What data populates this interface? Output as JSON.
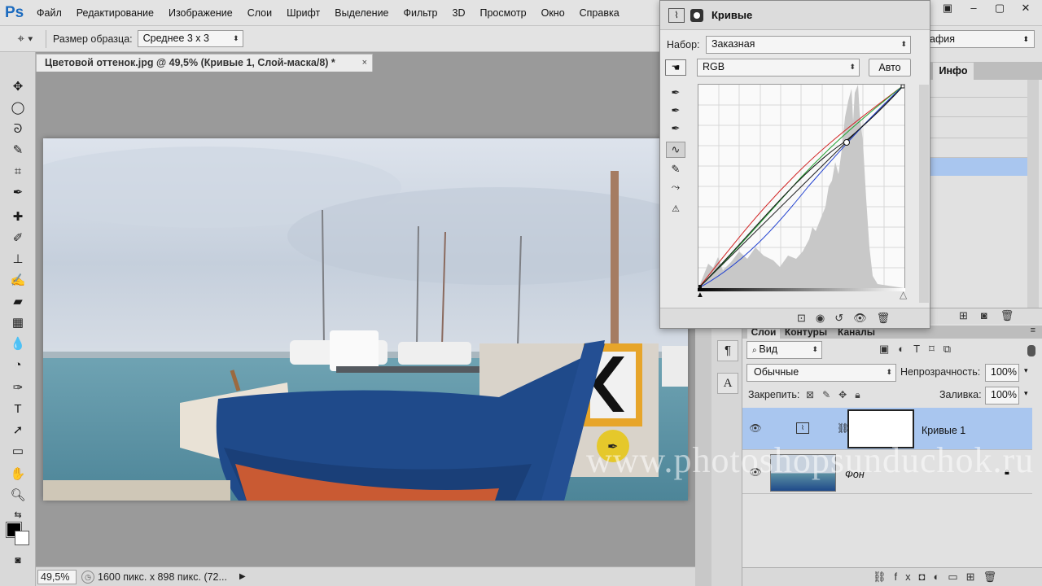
{
  "app": {
    "logo": "Ps"
  },
  "menu": [
    "Файл",
    "Редактирование",
    "Изображение",
    "Слои",
    "Шрифт",
    "Выделение",
    "Фильтр",
    "3D",
    "Просмотр",
    "Окно",
    "Справка"
  ],
  "options": {
    "sample_label": "Размер образца:",
    "sample_value": "Среднее 3 x 3"
  },
  "document": {
    "tab_title": "Цветовой оттенок.jpg @ 49,5% (Кривые 1, Слой-маска/8) *",
    "close": "×"
  },
  "status": {
    "zoom": "49,5%",
    "info": "1600 пикс. x 898 пикс. (72..."
  },
  "curves": {
    "title": "Кривые",
    "preset_label": "Набор:",
    "preset_value": "Заказная",
    "channel_value": "RGB",
    "auto_label": "Авто"
  },
  "right_panel": {
    "workspace_value": "афия",
    "info_tab": "Инфо"
  },
  "layers": {
    "tabs": [
      "Слои",
      "Контуры",
      "Каналы"
    ],
    "filter_value": "Вид",
    "blend_mode": "Обычные",
    "opacity_label": "Непрозрачность:",
    "opacity_value": "100%",
    "lock_label": "Закрепить:",
    "fill_label": "Заливка:",
    "fill_value": "100%",
    "items": [
      {
        "name": "Кривые 1",
        "selected": true
      },
      {
        "name": "Фон",
        "selected": false
      }
    ]
  },
  "watermark": "www.photoshopsunduchok.ru",
  "colors": {
    "accent": "#1c6bbf",
    "selection": "#a9c6ef",
    "canvas_bg": "#9a9a9a"
  }
}
